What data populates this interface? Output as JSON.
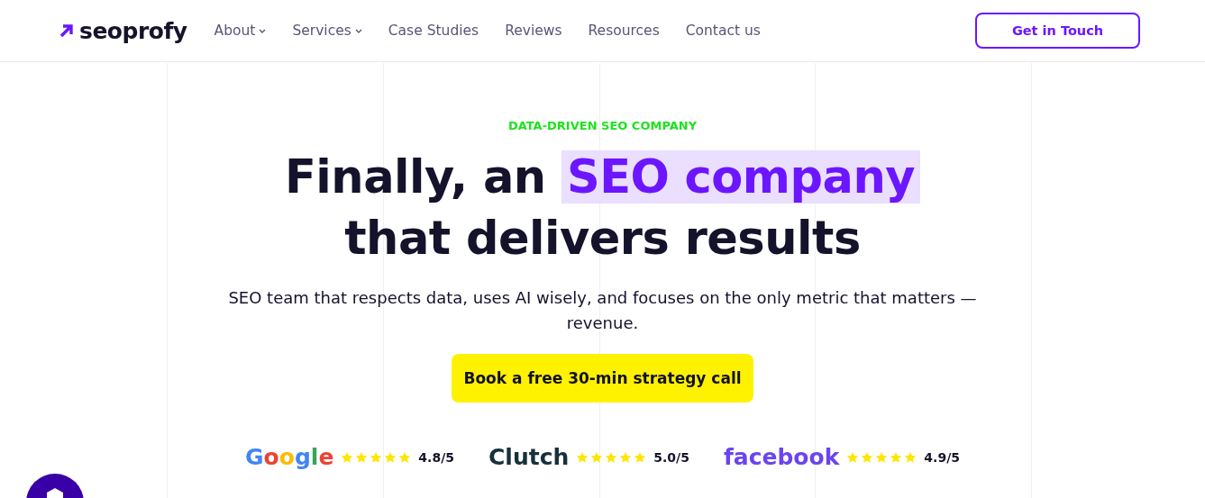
{
  "header": {
    "logo": "seoprofy",
    "nav": [
      {
        "label": "About",
        "dropdown": true
      },
      {
        "label": "Services",
        "dropdown": true
      },
      {
        "label": "Case Studies",
        "dropdown": false
      },
      {
        "label": "Reviews",
        "dropdown": false
      },
      {
        "label": "Resources",
        "dropdown": false
      },
      {
        "label": "Contact us",
        "dropdown": false
      }
    ],
    "cta": "Get in Touch"
  },
  "hero": {
    "eyebrow": "DATA-DRIVEN SEO COMPANY",
    "title_before": "Finally, an",
    "title_highlight": "SEO company",
    "title_after": "that delivers results",
    "subtitle": "SEO team that respects data, uses AI wisely, and focuses on the only metric that matters — revenue.",
    "button": "Book a free 30-min strategy call"
  },
  "ratings": [
    {
      "kind": "google",
      "name": "Google",
      "stars": 5,
      "score": "4.8/5"
    },
    {
      "kind": "clutch",
      "name": "Clutch",
      "stars": 5,
      "score": "5.0/5"
    },
    {
      "kind": "facebook",
      "name": "facebook",
      "stars": 5,
      "score": "4.9/5"
    }
  ]
}
